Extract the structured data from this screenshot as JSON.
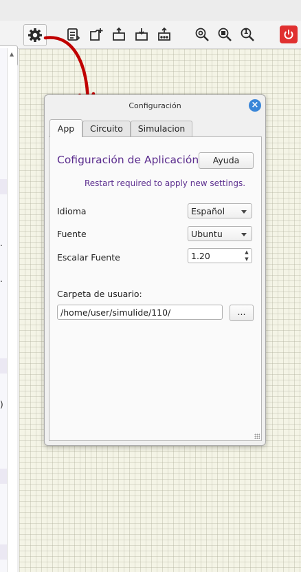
{
  "toolbar": {
    "icons": [
      "gear-icon",
      "file-list-icon",
      "new-file-icon",
      "open-folder-icon",
      "save-icon",
      "export-icon",
      "zoom-fit-icon",
      "zoom-selection-icon",
      "zoom-one-icon",
      "power-icon"
    ],
    "zoom_one_label": "1"
  },
  "dialog": {
    "title": "Configuración",
    "tabs": [
      "App",
      "Circuito",
      "Simulacion"
    ],
    "active_tab": "App",
    "heading": "Cofiguración de Aplicación",
    "help_button": "Ayuda",
    "restart_note": "Restart required to apply new settings.",
    "language_label": "Idioma",
    "language_value": "Español",
    "font_label": "Fuente",
    "font_value": "Ubuntu",
    "font_scale_label": "Escalar Fuente",
    "font_scale_value": "1.20",
    "user_folder_label": "Carpeta de usuario:",
    "user_folder_value": "/home/user/simulide/110/",
    "browse_button": "..."
  },
  "colors": {
    "accent": "#5b2d8e",
    "close_button": "#3a86d8",
    "power_button": "#e03030",
    "annotation_arrow": "#c00000",
    "canvas_bg": "#f4f4e6"
  }
}
